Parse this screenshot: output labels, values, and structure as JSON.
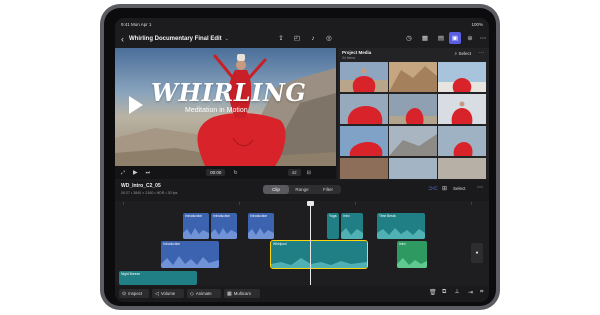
{
  "status_bar": {
    "time_date": "9:41   Mon Apr 1",
    "battery": "100%"
  },
  "nav": {
    "back_icon": "chevron-left-icon",
    "title": "Whirling Documentary Final Edit",
    "caret_icon": "chevron-down-icon"
  },
  "toolbar_icons": [
    "export-icon",
    "camera-icon",
    "microphone-icon",
    "voiceover-icon",
    "clock-icon",
    "browser-icon",
    "photos-icon",
    "inspector-icon",
    "more-icon"
  ],
  "viewer": {
    "title_text": "WHIRLING",
    "subtitle_text": "Meditation in Motion",
    "timecode": "00:00",
    "zoom": "42"
  },
  "media": {
    "header": "Project Media",
    "subheader": "34 items",
    "select_label": "Select"
  },
  "timeline_header": {
    "clip_name": "WD_Intro_C2_05",
    "clip_meta": "00:27 • 3840 × 2160 • HDR • 30 fps",
    "tabs": [
      "Clip",
      "Range",
      "Filter"
    ],
    "active_tab": "Clip",
    "select_label": "Select"
  },
  "clips": [
    {
      "label": "Introduction"
    },
    {
      "label": "Introduction"
    },
    {
      "label": "Introduction"
    },
    {
      "label": "Yoga"
    },
    {
      "label": "Intro"
    },
    {
      "label": "Time Break"
    },
    {
      "label": "Introduction"
    },
    {
      "label": "Whirlpool"
    },
    {
      "label": "Intro"
    },
    {
      "label": "Night Breeze"
    }
  ],
  "bottom_buttons": [
    {
      "label": "Inspect",
      "icon": "inspect-icon"
    },
    {
      "label": "Volume",
      "icon": "volume-icon"
    },
    {
      "label": "Animate",
      "icon": "animate-icon"
    },
    {
      "label": "Multicam",
      "icon": "multicam-icon"
    }
  ],
  "bottom_icons": [
    "trash-icon",
    "duplicate-icon",
    "split-icon",
    "detach-icon",
    "crop-icon"
  ],
  "colors": {
    "accent": "#5a5ee0",
    "selection": "#ffd60a",
    "dancer_red": "#d8232a",
    "clip_blue": "#3b63b0",
    "clip_cyan": "#1f7f84",
    "clip_green": "#2e9a62"
  }
}
